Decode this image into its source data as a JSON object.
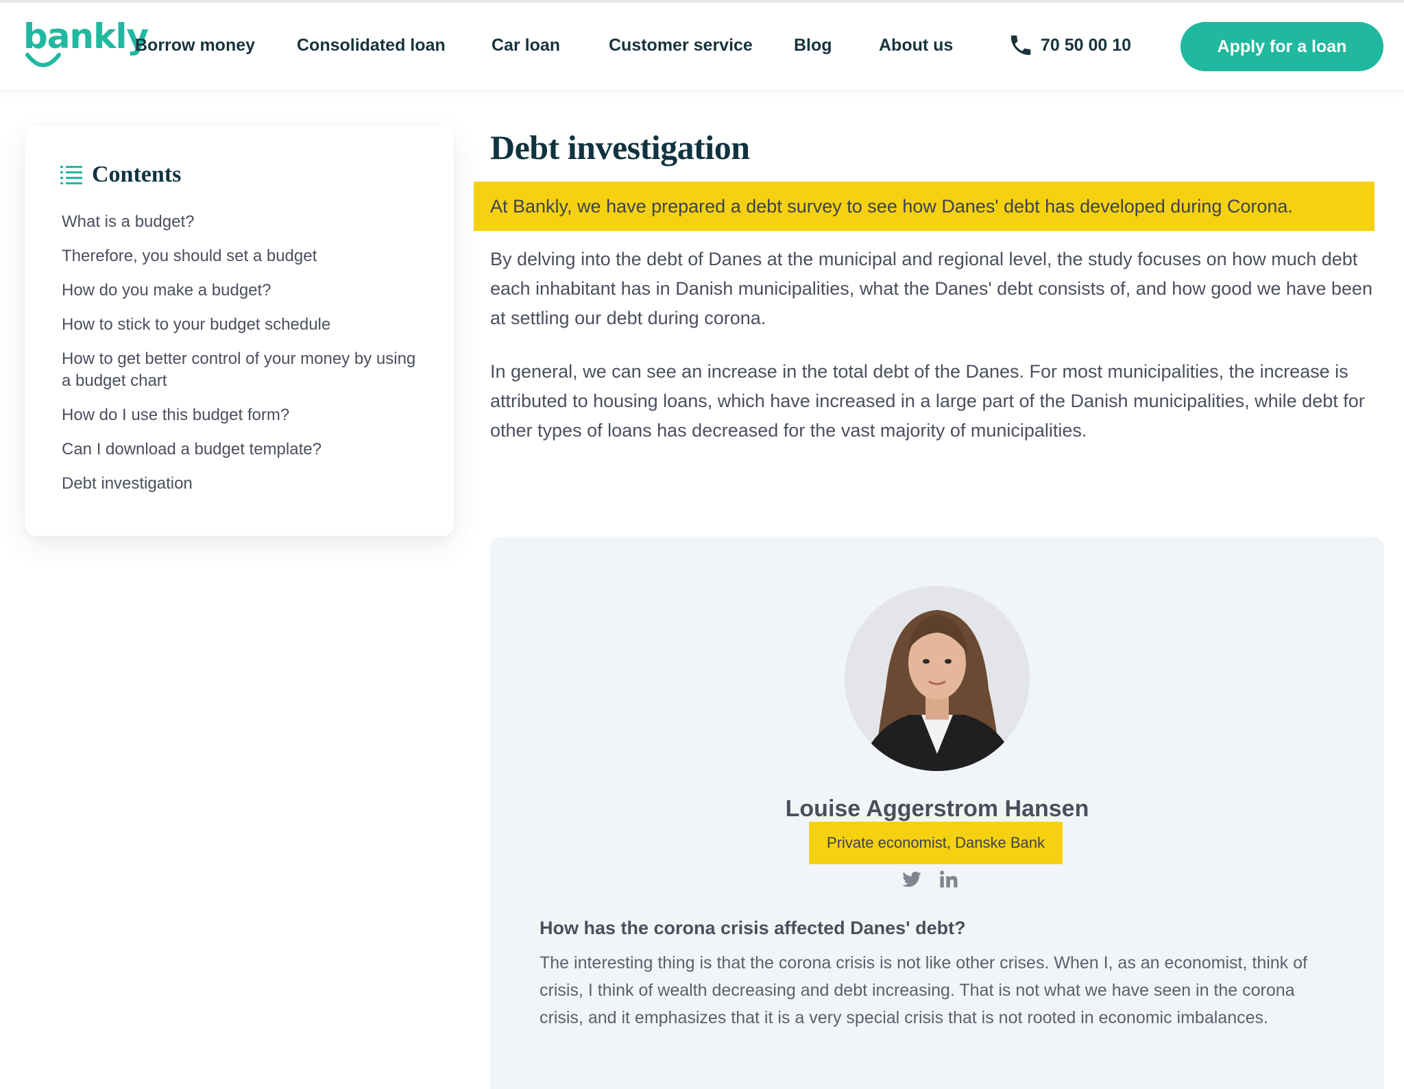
{
  "brand": {
    "name": "bankly",
    "color": "#21b8a0"
  },
  "nav": {
    "items": [
      {
        "label": "Borrow money"
      },
      {
        "label": "Consolidated loan"
      },
      {
        "label": "Car loan"
      },
      {
        "label": "Customer service"
      },
      {
        "label": "Blog"
      },
      {
        "label": "About us"
      }
    ],
    "phone": "70 50 00 10",
    "cta": "Apply for a loan"
  },
  "toc": {
    "title": "Contents",
    "items": [
      "What is a budget?",
      "Therefore, you should set a budget",
      "How do you make a budget?",
      "How to stick to your budget schedule",
      "How to get better control of your money by using a budget chart",
      "How do I use this budget form?",
      "Can I download a budget template?",
      "Debt investigation"
    ]
  },
  "main": {
    "title": "Debt investigation",
    "lead": "At Bankly, we have prepared a debt survey to see how Danes' debt has developed during Corona.",
    "paragraphs": [
      "By delving into the debt of Danes at the municipal and regional level, the study focuses on how much debt each inhabitant has in Danish municipalities, what the Danes' debt consists of, and how good we have been at settling our debt during corona.",
      "In general, we can see an increase in the total debt of the Danes. For most municipalities, the increase is attributed to housing loans, which have increased in a large part of the Danish municipalities, while debt for other types of loans has decreased for the vast majority of municipalities."
    ]
  },
  "expert": {
    "name": "Louise Aggerstrom Hansen",
    "role": "Private economist, Danske Bank",
    "question": "How has the corona crisis affected Danes' debt?",
    "answer": "The interesting thing is that the corona crisis is not like other crises. When I, as an economist, think of crisis, I think of wealth decreasing and debt increasing. That is not what we have seen in the corona crisis, and it emphasizes that it is a very special crisis that is not rooted in economic imbalances."
  },
  "colors": {
    "highlight": "#f5d10f",
    "heading": "#0f3340",
    "card": "#f2f5f8"
  }
}
